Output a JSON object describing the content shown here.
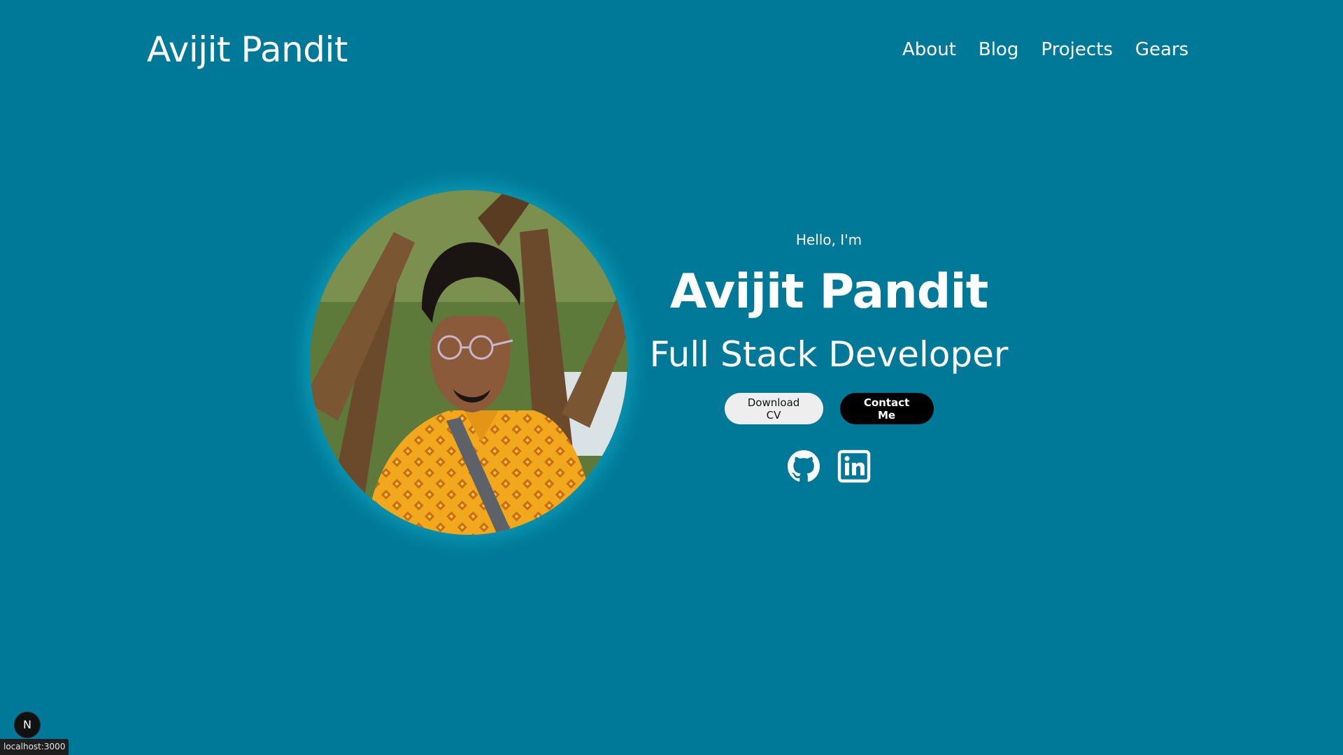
{
  "header": {
    "logo_text": "Avijit Pandit",
    "nav": [
      {
        "label": "About"
      },
      {
        "label": "Blog"
      },
      {
        "label": "Projects"
      },
      {
        "label": "Gears"
      }
    ]
  },
  "hero": {
    "greeting": "Hello, I'm",
    "name": "Avijit Pandit",
    "role": "Full Stack Developer",
    "download_cv_label": "Download CV",
    "contact_label": "Contact Me",
    "socials": [
      {
        "icon": "github-icon"
      },
      {
        "icon": "linkedin-icon"
      }
    ]
  },
  "devtools": {
    "badge_letter": "N",
    "status_url": "localhost:3000"
  },
  "colors": {
    "background": "#007897",
    "text": "#ffffff",
    "button_light": "#eeeeee",
    "button_dark": "#000000"
  }
}
